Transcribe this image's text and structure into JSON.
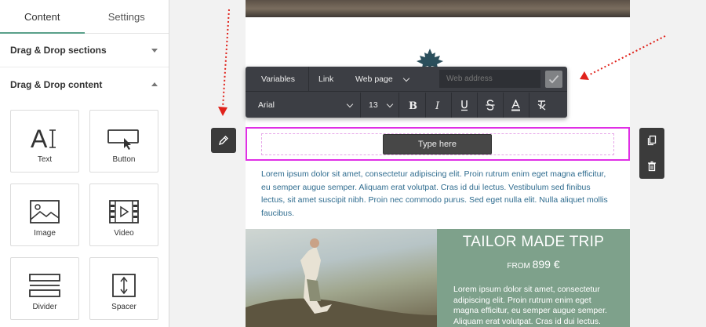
{
  "sidebar": {
    "tabs": [
      {
        "label": "Content",
        "active": true
      },
      {
        "label": "Settings",
        "active": false
      }
    ],
    "sections": [
      {
        "label": "Drag & Drop sections",
        "expanded": false
      },
      {
        "label": "Drag & Drop content",
        "expanded": true
      }
    ],
    "blocks": [
      {
        "label": "Text",
        "icon": "text-icon"
      },
      {
        "label": "Button",
        "icon": "button-icon"
      },
      {
        "label": "Image",
        "icon": "image-icon"
      },
      {
        "label": "Video",
        "icon": "video-icon"
      },
      {
        "label": "Divider",
        "icon": "divider-icon"
      },
      {
        "label": "Spacer",
        "icon": "spacer-icon"
      }
    ]
  },
  "toolbar": {
    "variables_label": "Variables",
    "link_label": "Link",
    "link_type": "Web page",
    "url_placeholder": "Web address",
    "font_family": "Arial",
    "font_size": "13",
    "format_buttons": [
      "bold-icon",
      "italic-icon",
      "underline-icon",
      "strikethrough-icon",
      "text-color-icon",
      "clear-format-icon"
    ]
  },
  "email": {
    "button_text": "Type here",
    "paragraph": "Lorem ipsum dolor sit amet, consectetur adipiscing elit. Proin rutrum enim eget magna efficitur, eu semper augue semper. Aliquam erat volutpat. Cras id dui lectus. Vestibulum sed finibus lectus, sit amet suscipit nibh. Proin nec commodo purus. Sed eget nulla elit. Nulla aliquet mollis faucibus.",
    "trip": {
      "title": "TAILOR MADE TRIP",
      "from_label": "FROM",
      "price": "899 €",
      "text": "Lorem ipsum dolor sit amet, consectetur adipiscing elit. Proin rutrum enim eget magna efficitur, eu semper augue semper. Aliquam erat volutpat. Cras id dui lectus."
    }
  },
  "colors": {
    "accent": "#5aa08a",
    "selection": "#e02fe5",
    "link_text": "#2f6c8f",
    "trip_bg": "#7ea18b",
    "toolbar_bg": "#3c3e44",
    "arrow": "#e0221b"
  },
  "tools": [
    "edit-icon",
    "copy-icon",
    "delete-icon"
  ]
}
